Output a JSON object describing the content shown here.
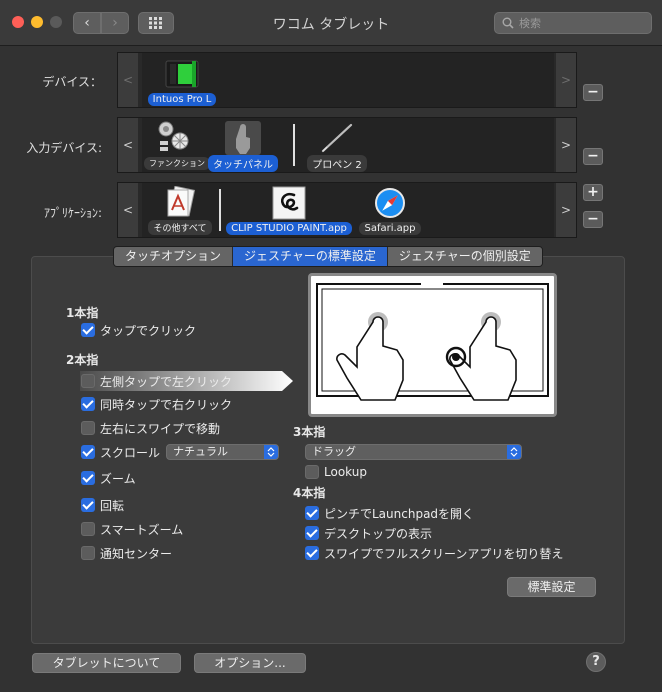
{
  "window": {
    "title": "ワコム タブレット"
  },
  "toolbar": {
    "back_glyph": "‹",
    "forward_glyph": "›",
    "search_placeholder": "検索"
  },
  "rows": {
    "device": {
      "label": "デバイス：",
      "items": [
        {
          "label": "Intuos Pro L",
          "selected": true
        }
      ]
    },
    "input": {
      "label": "入力デバイス:",
      "items": [
        {
          "label": "ファンクション",
          "selected": false
        },
        {
          "label": "タッチパネル",
          "selected": true
        },
        {
          "label": "プロペン 2",
          "selected": false
        }
      ]
    },
    "app": {
      "label": "ｱﾌﾟﾘｹｰｼｮﾝ:",
      "items": [
        {
          "label": "その他すべて",
          "selected": false
        },
        {
          "label": "CLIP STUDIO PAINT.app",
          "selected": true
        },
        {
          "label": "Safari.app",
          "selected": false
        }
      ]
    },
    "arrow_left": "<",
    "arrow_right": ">",
    "plus": "+",
    "minus": "−"
  },
  "tabs": [
    {
      "label": "タッチオプション",
      "active": false
    },
    {
      "label": "ジェスチャーの標準設定",
      "active": true
    },
    {
      "label": "ジェスチャーの個別設定",
      "active": false
    }
  ],
  "one_finger": {
    "heading": "1本指",
    "items": [
      {
        "label": "タップでクリック",
        "checked": true
      }
    ]
  },
  "two_finger": {
    "heading": "2本指",
    "items": [
      {
        "label": "左側タップで左クリック",
        "checked": false
      },
      {
        "label": "同時タップで右クリック",
        "checked": true
      },
      {
        "label": "左右にスワイプで移動",
        "checked": false
      },
      {
        "label": "スクロール",
        "checked": true
      },
      {
        "label": "ズーム",
        "checked": true
      },
      {
        "label": "回転",
        "checked": true
      },
      {
        "label": "スマートズーム",
        "checked": false
      },
      {
        "label": "通知センター",
        "checked": false
      }
    ],
    "scroll_select": "ナチュラル"
  },
  "three_finger": {
    "heading": "3本指",
    "select": "ドラッグ",
    "items": [
      {
        "label": "Lookup",
        "checked": false
      }
    ]
  },
  "four_finger": {
    "heading": "4本指",
    "items": [
      {
        "label": "ピンチでLaunchpadを開く",
        "checked": true
      },
      {
        "label": "デスクトップの表示",
        "checked": true
      },
      {
        "label": "スワイプでフルスクリーンアプリを切り替え",
        "checked": true
      }
    ]
  },
  "buttons": {
    "default": "標準設定",
    "about": "タブレットについて",
    "options": "オプション...",
    "help": "?"
  },
  "colors": {
    "accent": "#2a66d0",
    "checkbox_on": "#2a6de0",
    "selection_pill": "#1c5fd3"
  }
}
